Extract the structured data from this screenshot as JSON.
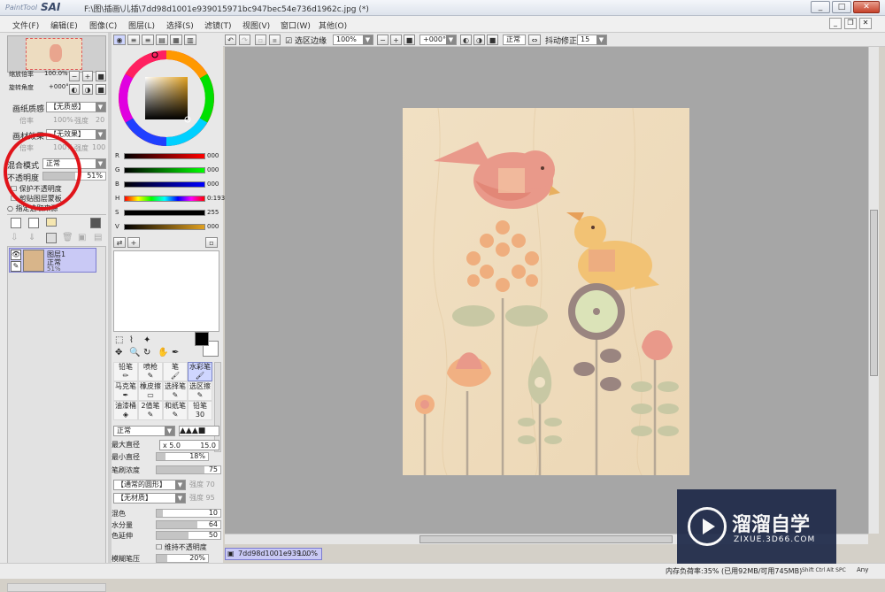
{
  "app": {
    "logo_small": "PaintTool",
    "logo_big": "SAI",
    "title": "F:\\图\\插画\\儿插\\7dd98d1001e939015971bc947bec54e736d1962c.jpg (*)"
  },
  "window_buttons": [
    "_",
    "□",
    "✕"
  ],
  "menu": [
    "文件(F)",
    "编辑(E)",
    "图像(C)",
    "图层(L)",
    "选择(S)",
    "滤镜(T)",
    "视图(V)",
    "窗口(W)",
    "其他(O)"
  ],
  "nav": {
    "zoom_label": "缩放倍率",
    "zoom_value": "100.0%",
    "rotate_label": "旋转角度",
    "rotate_value": "+000°"
  },
  "paper_props": {
    "texture_label": "画纸质感",
    "texture_value": "【无质感】",
    "tex_scale": "倍率",
    "tex_scale_val": "100%",
    "tex_strength": "强度",
    "tex_strength_val": "20",
    "effect_label": "画材效果",
    "effect_value": "【无效果】",
    "eff_scale": "倍率",
    "eff_scale_val": "100%",
    "eff_strength": "强度",
    "eff_strength_val": "100"
  },
  "layer_props": {
    "blend_label": "混合模式",
    "blend_value": "正常",
    "opacity_label": "不透明度",
    "opacity_value": "51%",
    "opacity": 0.51,
    "protect_label": "保护不透明度",
    "clip_label": "剪贴图层蒙板",
    "select_src_label": "指定选取来源"
  },
  "layer": {
    "name": "图层1",
    "mode": "正常",
    "opacity": "51%"
  },
  "colors": {
    "accent": "#2f2f9f",
    "selection": "#c9c9f5",
    "red_circle": "#e0141a",
    "wheel_ring_note": "hsv"
  },
  "sliders": [
    {
      "key": "R",
      "value": "000"
    },
    {
      "key": "G",
      "value": "000"
    },
    {
      "key": "B",
      "value": "000"
    },
    {
      "key": "H",
      "value": "0:193"
    },
    {
      "key": "S",
      "value": "255"
    },
    {
      "key": "V",
      "value": "000"
    }
  ],
  "tools": [
    "铅笔",
    "喷枪",
    "笔",
    "水彩笔",
    "马克笔",
    "橡皮擦",
    "选择笔",
    "选区擦",
    "油漆桶",
    "2值笔",
    "和纸笔",
    "铅笔30"
  ],
  "brush": {
    "mode": "正常",
    "max_size_label": "最大直径",
    "max_size_mult": "x 5.0",
    "max_size_val": "15.0",
    "min_size_label": "最小直径",
    "min_size_val": "18%",
    "min_size": 0.18,
    "density_label": "笔刷浓度",
    "density_val": "75",
    "density": 0.75,
    "shape_value": "【通常的圆形】",
    "shape_strength": "强度",
    "shape_strength_val": "70",
    "texture_value": "【无材质】",
    "texture_strength": "强度",
    "texture_strength_val": "95",
    "blend_label": "混色",
    "blend_val": "10",
    "blend": 0.1,
    "water_label": "水分量",
    "water_val": "64",
    "water": 0.64,
    "extend_label": "色延伸",
    "extend_val": "50",
    "extend": 0.5,
    "keep_opacity_label": "维持不透明度",
    "blur_label": "模糊笔压",
    "blur_val": "20%",
    "blur": 0.2
  },
  "toolbar": {
    "select_edge_label": "选区边缘",
    "zoom": "100%",
    "rotate": "+000°",
    "mode": "正常",
    "stabilizer_label": "抖动修正",
    "stabilizer_val": "15"
  },
  "doc_tab": {
    "name": "7dd98d1001e939...",
    "zoom": "100%"
  },
  "status": {
    "memory": "内存负荷率:35% (已用92MB/可用745MB)",
    "keys": "Shift Ctrl Alt SPC",
    "any": "Any"
  },
  "watermark": {
    "brand": "溜溜自学",
    "url": "ZIXUE.3D66.COM"
  }
}
